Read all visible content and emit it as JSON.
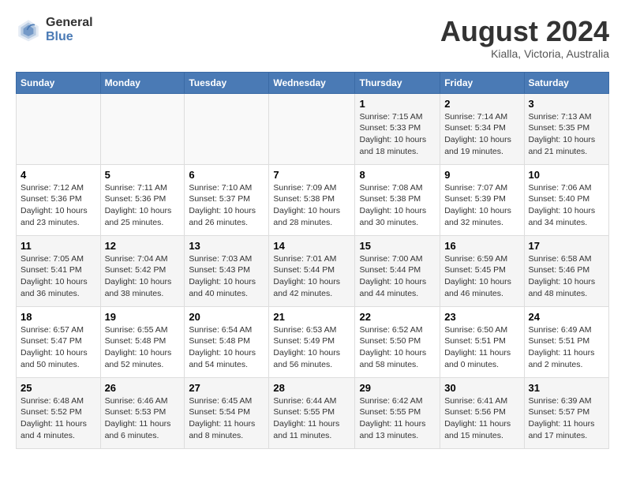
{
  "logo": {
    "general": "General",
    "blue": "Blue"
  },
  "header": {
    "month_year": "August 2024",
    "location": "Kialla, Victoria, Australia"
  },
  "days_of_week": [
    "Sunday",
    "Monday",
    "Tuesday",
    "Wednesday",
    "Thursday",
    "Friday",
    "Saturday"
  ],
  "weeks": [
    [
      {
        "day": "",
        "info": ""
      },
      {
        "day": "",
        "info": ""
      },
      {
        "day": "",
        "info": ""
      },
      {
        "day": "",
        "info": ""
      },
      {
        "day": "1",
        "info": "Sunrise: 7:15 AM\nSunset: 5:33 PM\nDaylight: 10 hours\nand 18 minutes."
      },
      {
        "day": "2",
        "info": "Sunrise: 7:14 AM\nSunset: 5:34 PM\nDaylight: 10 hours\nand 19 minutes."
      },
      {
        "day": "3",
        "info": "Sunrise: 7:13 AM\nSunset: 5:35 PM\nDaylight: 10 hours\nand 21 minutes."
      }
    ],
    [
      {
        "day": "4",
        "info": "Sunrise: 7:12 AM\nSunset: 5:36 PM\nDaylight: 10 hours\nand 23 minutes."
      },
      {
        "day": "5",
        "info": "Sunrise: 7:11 AM\nSunset: 5:36 PM\nDaylight: 10 hours\nand 25 minutes."
      },
      {
        "day": "6",
        "info": "Sunrise: 7:10 AM\nSunset: 5:37 PM\nDaylight: 10 hours\nand 26 minutes."
      },
      {
        "day": "7",
        "info": "Sunrise: 7:09 AM\nSunset: 5:38 PM\nDaylight: 10 hours\nand 28 minutes."
      },
      {
        "day": "8",
        "info": "Sunrise: 7:08 AM\nSunset: 5:38 PM\nDaylight: 10 hours\nand 30 minutes."
      },
      {
        "day": "9",
        "info": "Sunrise: 7:07 AM\nSunset: 5:39 PM\nDaylight: 10 hours\nand 32 minutes."
      },
      {
        "day": "10",
        "info": "Sunrise: 7:06 AM\nSunset: 5:40 PM\nDaylight: 10 hours\nand 34 minutes."
      }
    ],
    [
      {
        "day": "11",
        "info": "Sunrise: 7:05 AM\nSunset: 5:41 PM\nDaylight: 10 hours\nand 36 minutes."
      },
      {
        "day": "12",
        "info": "Sunrise: 7:04 AM\nSunset: 5:42 PM\nDaylight: 10 hours\nand 38 minutes."
      },
      {
        "day": "13",
        "info": "Sunrise: 7:03 AM\nSunset: 5:43 PM\nDaylight: 10 hours\nand 40 minutes."
      },
      {
        "day": "14",
        "info": "Sunrise: 7:01 AM\nSunset: 5:44 PM\nDaylight: 10 hours\nand 42 minutes."
      },
      {
        "day": "15",
        "info": "Sunrise: 7:00 AM\nSunset: 5:44 PM\nDaylight: 10 hours\nand 44 minutes."
      },
      {
        "day": "16",
        "info": "Sunrise: 6:59 AM\nSunset: 5:45 PM\nDaylight: 10 hours\nand 46 minutes."
      },
      {
        "day": "17",
        "info": "Sunrise: 6:58 AM\nSunset: 5:46 PM\nDaylight: 10 hours\nand 48 minutes."
      }
    ],
    [
      {
        "day": "18",
        "info": "Sunrise: 6:57 AM\nSunset: 5:47 PM\nDaylight: 10 hours\nand 50 minutes."
      },
      {
        "day": "19",
        "info": "Sunrise: 6:55 AM\nSunset: 5:48 PM\nDaylight: 10 hours\nand 52 minutes."
      },
      {
        "day": "20",
        "info": "Sunrise: 6:54 AM\nSunset: 5:48 PM\nDaylight: 10 hours\nand 54 minutes."
      },
      {
        "day": "21",
        "info": "Sunrise: 6:53 AM\nSunset: 5:49 PM\nDaylight: 10 hours\nand 56 minutes."
      },
      {
        "day": "22",
        "info": "Sunrise: 6:52 AM\nSunset: 5:50 PM\nDaylight: 10 hours\nand 58 minutes."
      },
      {
        "day": "23",
        "info": "Sunrise: 6:50 AM\nSunset: 5:51 PM\nDaylight: 11 hours\nand 0 minutes."
      },
      {
        "day": "24",
        "info": "Sunrise: 6:49 AM\nSunset: 5:51 PM\nDaylight: 11 hours\nand 2 minutes."
      }
    ],
    [
      {
        "day": "25",
        "info": "Sunrise: 6:48 AM\nSunset: 5:52 PM\nDaylight: 11 hours\nand 4 minutes."
      },
      {
        "day": "26",
        "info": "Sunrise: 6:46 AM\nSunset: 5:53 PM\nDaylight: 11 hours\nand 6 minutes."
      },
      {
        "day": "27",
        "info": "Sunrise: 6:45 AM\nSunset: 5:54 PM\nDaylight: 11 hours\nand 8 minutes."
      },
      {
        "day": "28",
        "info": "Sunrise: 6:44 AM\nSunset: 5:55 PM\nDaylight: 11 hours\nand 11 minutes."
      },
      {
        "day": "29",
        "info": "Sunrise: 6:42 AM\nSunset: 5:55 PM\nDaylight: 11 hours\nand 13 minutes."
      },
      {
        "day": "30",
        "info": "Sunrise: 6:41 AM\nSunset: 5:56 PM\nDaylight: 11 hours\nand 15 minutes."
      },
      {
        "day": "31",
        "info": "Sunrise: 6:39 AM\nSunset: 5:57 PM\nDaylight: 11 hours\nand 17 minutes."
      }
    ]
  ]
}
